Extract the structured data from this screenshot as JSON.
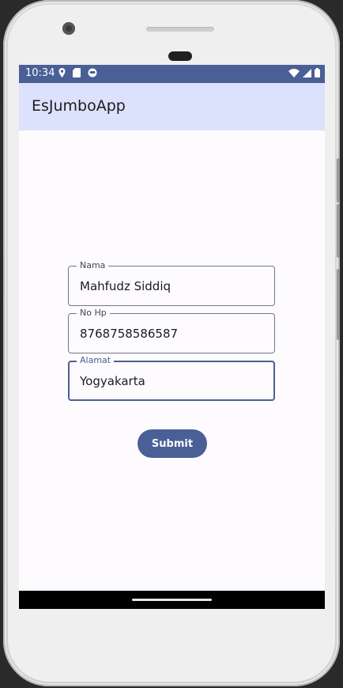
{
  "status_bar": {
    "time": "10:34",
    "left_icons": [
      "location-icon",
      "sd-card-icon",
      "face-icon"
    ],
    "right_icons": [
      "wifi-icon",
      "signal-icon",
      "battery-icon"
    ],
    "color": "#4a5f96"
  },
  "app_bar": {
    "title": "EsJumboApp",
    "color": "#dce2fb"
  },
  "form": {
    "nama": {
      "label": "Nama",
      "value": "Mahfudz Siddiq"
    },
    "no_hp": {
      "label": "No Hp",
      "value": "8768758586587"
    },
    "alamat": {
      "label": "Alamat",
      "value": "Yogyakarta",
      "focused": true
    },
    "submit_label": "Submit"
  },
  "colors": {
    "accent": "#4a5f96",
    "surface": "#fdfbfe",
    "outline": "#767680"
  }
}
